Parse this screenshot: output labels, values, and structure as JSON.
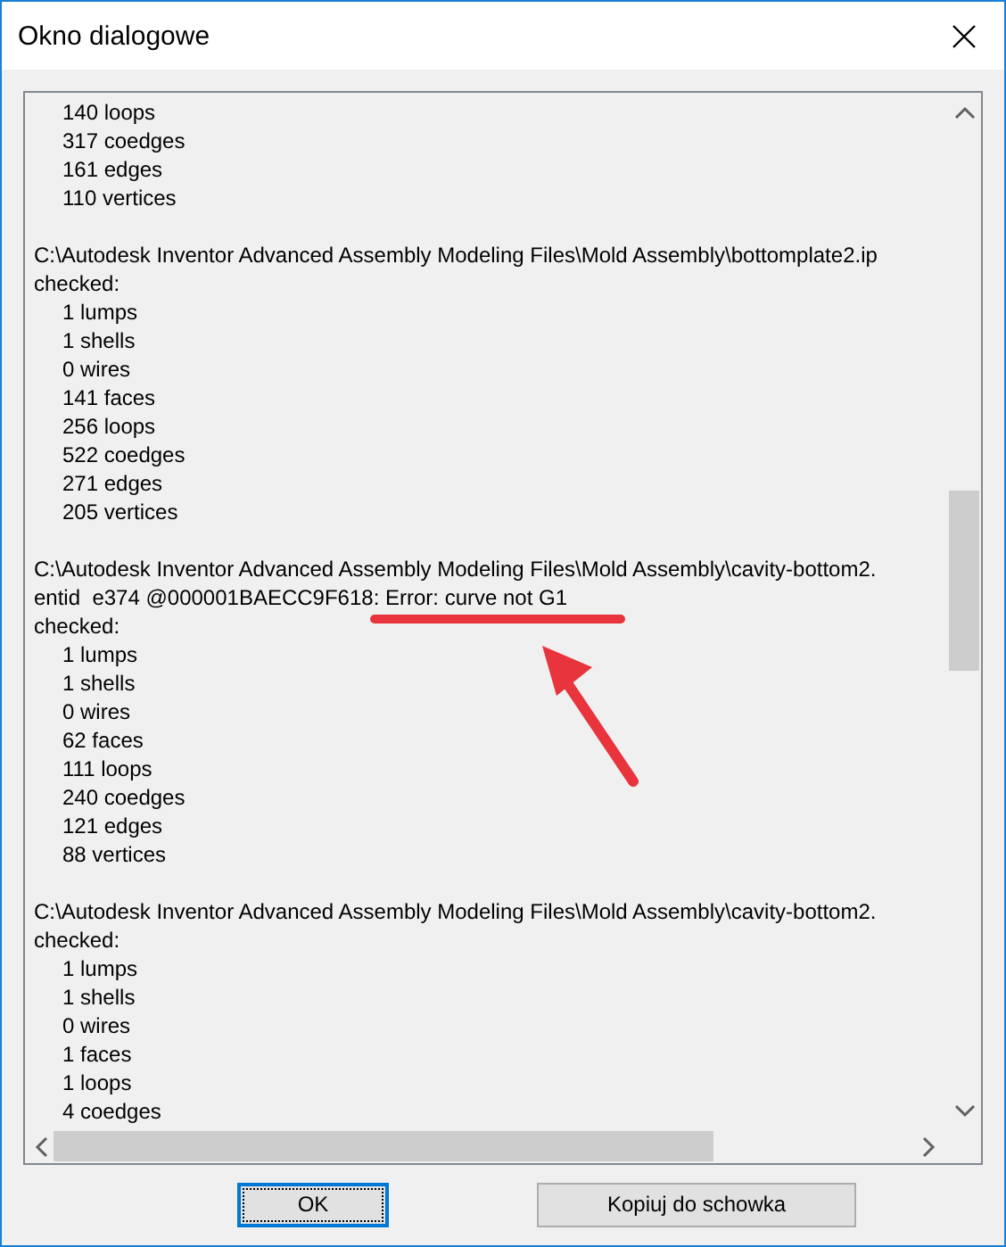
{
  "window": {
    "title": "Okno dialogowe"
  },
  "log_lines": [
    {
      "kind": "item",
      "text": "140 loops"
    },
    {
      "kind": "item",
      "text": "317 coedges"
    },
    {
      "kind": "item",
      "text": "161 edges"
    },
    {
      "kind": "item",
      "text": "110 vertices"
    },
    {
      "kind": "blank"
    },
    {
      "kind": "line",
      "text": "C:\\Autodesk Inventor Advanced Assembly Modeling Files\\Mold Assembly\\bottomplate2.ip"
    },
    {
      "kind": "line",
      "text": "checked:"
    },
    {
      "kind": "item",
      "text": "1 lumps"
    },
    {
      "kind": "item",
      "text": "1 shells"
    },
    {
      "kind": "item",
      "text": "0 wires"
    },
    {
      "kind": "item",
      "text": "141 faces"
    },
    {
      "kind": "item",
      "text": "256 loops"
    },
    {
      "kind": "item",
      "text": "522 coedges"
    },
    {
      "kind": "item",
      "text": "271 edges"
    },
    {
      "kind": "item",
      "text": "205 vertices"
    },
    {
      "kind": "blank"
    },
    {
      "kind": "line",
      "text": "C:\\Autodesk Inventor Advanced Assembly Modeling Files\\Mold Assembly\\cavity-bottom2."
    },
    {
      "kind": "error",
      "text": "entid  e374 @000001BAECC9F618: Error: curve not G1"
    },
    {
      "kind": "line",
      "text": "checked:"
    },
    {
      "kind": "item",
      "text": "1 lumps"
    },
    {
      "kind": "item",
      "text": "1 shells"
    },
    {
      "kind": "item",
      "text": "0 wires"
    },
    {
      "kind": "item",
      "text": "62 faces"
    },
    {
      "kind": "item",
      "text": "111 loops"
    },
    {
      "kind": "item",
      "text": "240 coedges"
    },
    {
      "kind": "item",
      "text": "121 edges"
    },
    {
      "kind": "item",
      "text": "88 vertices"
    },
    {
      "kind": "blank"
    },
    {
      "kind": "line",
      "text": "C:\\Autodesk Inventor Advanced Assembly Modeling Files\\Mold Assembly\\cavity-bottom2."
    },
    {
      "kind": "line",
      "text": "checked:"
    },
    {
      "kind": "item",
      "text": "1 lumps"
    },
    {
      "kind": "item",
      "text": "1 shells"
    },
    {
      "kind": "item",
      "text": "0 wires"
    },
    {
      "kind": "item",
      "text": "1 faces"
    },
    {
      "kind": "item",
      "text": "1 loops"
    },
    {
      "kind": "item",
      "text": "4 coedges"
    }
  ],
  "buttons": [
    {
      "label": "OK",
      "focused": true
    },
    {
      "label": "Kopiuj do schowka",
      "focused": false
    }
  ]
}
